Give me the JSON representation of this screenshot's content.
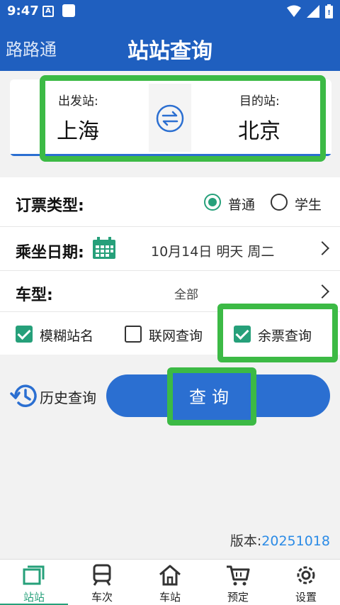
{
  "status_bar": {
    "time": "9:47",
    "notif_letter": "A"
  },
  "app_bar": {
    "back_label": "路路通",
    "title": "站站查询"
  },
  "stations": {
    "from_label": "出发站:",
    "from_city": "上海",
    "to_label": "目的站:",
    "to_city": "北京"
  },
  "ticket_type": {
    "label": "订票类型:",
    "options": [
      {
        "label": "普通",
        "checked": true
      },
      {
        "label": "学生",
        "checked": false
      }
    ]
  },
  "date": {
    "label": "乘坐日期:",
    "value": "10月14日 明天 周二"
  },
  "car_type": {
    "label": "车型:",
    "value": "全部"
  },
  "options": [
    {
      "label": "模糊站名",
      "checked": true
    },
    {
      "label": "联网查询",
      "checked": false
    },
    {
      "label": "余票查询",
      "checked": true
    }
  ],
  "history_label": "历史查询",
  "query_label": "查询",
  "version": {
    "prefix": "版本:",
    "number": "20251018"
  },
  "tabs": [
    {
      "label": "站站",
      "icon": "station-to-station-icon",
      "active": true
    },
    {
      "label": "车次",
      "icon": "train-icon",
      "active": false
    },
    {
      "label": "车站",
      "icon": "home-station-icon",
      "active": false
    },
    {
      "label": "预定",
      "icon": "cart-icon",
      "active": false
    },
    {
      "label": "设置",
      "icon": "gear-icon",
      "active": false
    }
  ],
  "colors": {
    "primary": "#1f5fbf",
    "accent_green": "#26a07a",
    "highlight": "#3cba45",
    "button": "#2b6fd1"
  }
}
